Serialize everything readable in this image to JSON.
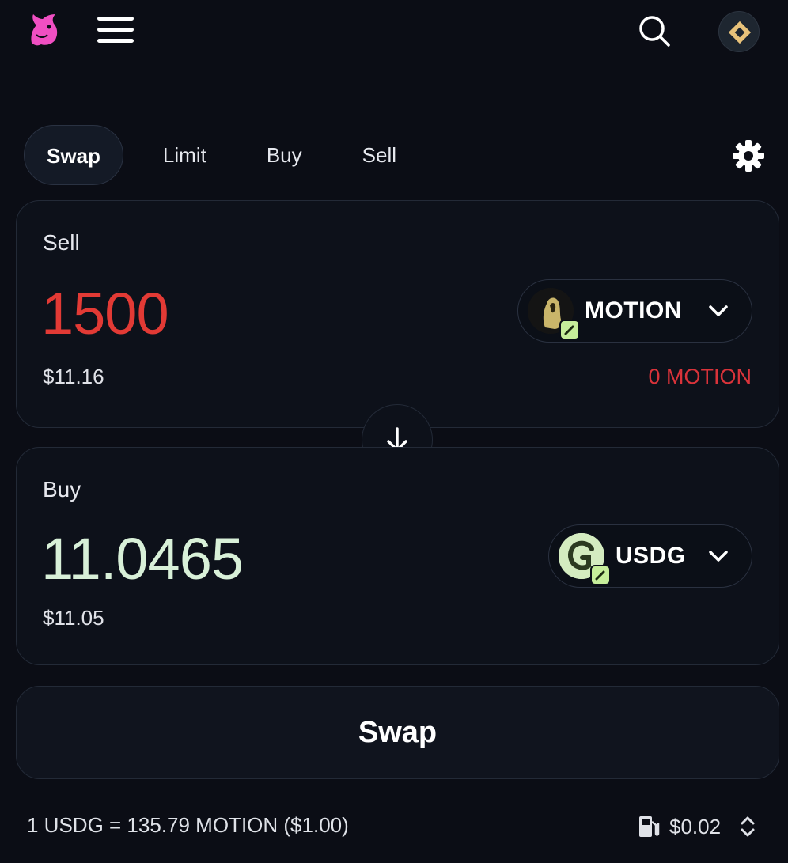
{
  "header": {
    "logo_icon": "unicorn-logo-icon",
    "menu_icon": "hamburger-menu-icon",
    "search_icon": "search-icon",
    "account_icon": "wallet-avatar-icon"
  },
  "tabs": [
    {
      "label": "Swap",
      "active": true
    },
    {
      "label": "Limit",
      "active": false
    },
    {
      "label": "Buy",
      "active": false
    },
    {
      "label": "Sell",
      "active": false
    }
  ],
  "settings_icon": "gear-icon",
  "sell": {
    "label": "Sell",
    "amount": "1500",
    "usd_value": "$11.16",
    "token": "MOTION",
    "balance": "0 MOTION"
  },
  "switch_icon": "arrow-down-icon",
  "buy": {
    "label": "Buy",
    "amount": "11.0465",
    "usd_value": "$11.05",
    "token": "USDG"
  },
  "swap_button": "Swap",
  "footer": {
    "rate": "1 USDG = 135.79 MOTION ($1.00)",
    "gas_fee": "$0.02",
    "gas_icon": "gas-pump-icon",
    "expand_icon": "chevron-up-down-icon"
  },
  "colors": {
    "background": "#0b0d15",
    "sell_amount": "#e23a35",
    "buy_amount": "#d8f0d8",
    "balance_warning": "#d9333a",
    "logo_pink": "#f04fc2"
  }
}
